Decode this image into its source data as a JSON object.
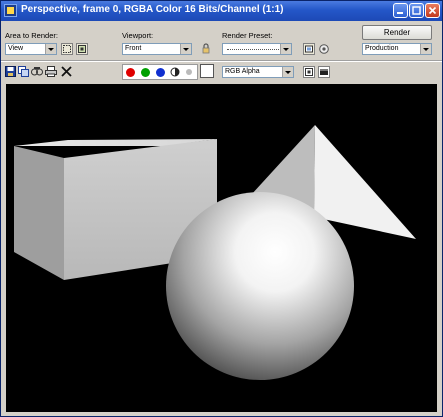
{
  "window": {
    "title": "Perspective, frame 0, RGBA Color 16 Bits/Channel (1:1)"
  },
  "toolbar": {
    "area_label": "Area to Render:",
    "area_value": "View",
    "viewport_label": "Viewport:",
    "viewport_value": "Front",
    "preset_label": "Render Preset:",
    "preset_value": "",
    "render_button": "Render",
    "production_value": "Production",
    "channel_value": "RGB Alpha"
  },
  "channels": [
    {
      "name": "red",
      "color": "#e00000"
    },
    {
      "name": "green",
      "color": "#00a000"
    },
    {
      "name": "blue",
      "color": "#1030d0"
    }
  ],
  "colors": {
    "titlebar": "#2457c8",
    "canvas_bg": "#000000",
    "window_bg": "#d4d0c8"
  },
  "scene": {
    "objects": [
      "box",
      "pyramid",
      "sphere"
    ]
  }
}
